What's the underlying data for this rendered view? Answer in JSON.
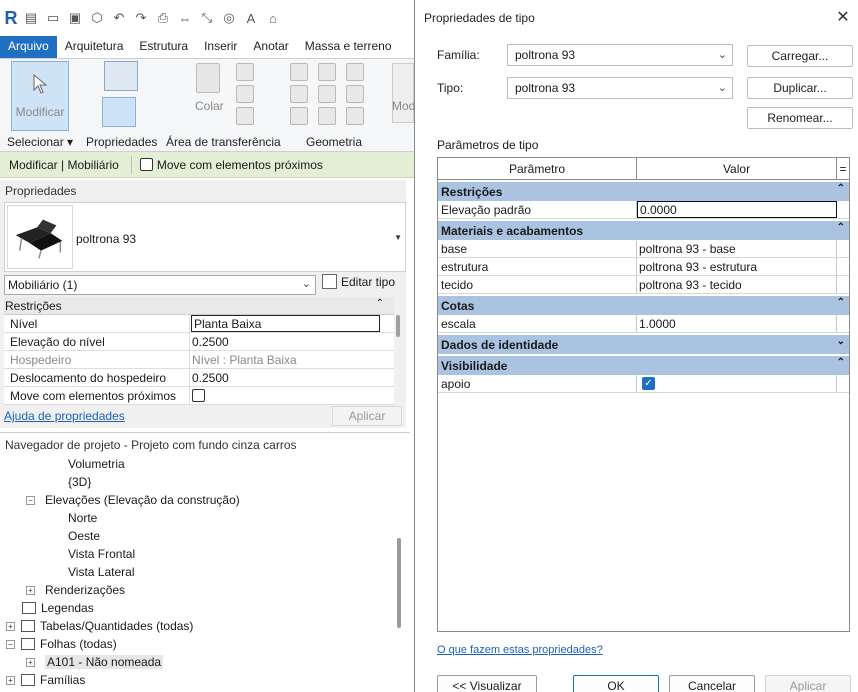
{
  "ribbon": {
    "menu": [
      "Arquivo",
      "Arquitetura",
      "Estrutura",
      "Inserir",
      "Anotar",
      "Massa e terreno"
    ],
    "modify_label": "Modificar",
    "select_label": "Selecionar",
    "properties_label": "Propriedades",
    "clipboard_label": "Área de transferência",
    "geometry_label": "Geometria",
    "paste_label": "Colar",
    "modify_partial_label": "Mod"
  },
  "context_bar": {
    "title": "Modificar | Mobiliário",
    "move_with_nearby": "Move com elementos próximos"
  },
  "properties": {
    "title": "Propriedades",
    "type_name": "poltrona 93",
    "filter": "Mobiliário (1)",
    "edit_type": "Editar tipo",
    "group": "Restrições",
    "rows": [
      {
        "k": "Nível",
        "v": "Planta Baixa"
      },
      {
        "k": "Elevação do nível",
        "v": "0.2500"
      },
      {
        "k": "Hospedeiro",
        "v": "Nível : Planta Baixa"
      },
      {
        "k": "Deslocamento do hospedeiro",
        "v": "0.2500"
      },
      {
        "k": "Move com elementos próximos",
        "v": ""
      }
    ],
    "help": "Ajuda de propriedades",
    "apply": "Aplicar"
  },
  "browser": {
    "title": "Navegador de projeto - Projeto com fundo cinza carros",
    "nodes": [
      {
        "label": "Volumetria"
      },
      {
        "label": "{3D}"
      },
      {
        "label": "Elevações (Elevação da construção)"
      },
      {
        "label": "Norte"
      },
      {
        "label": "Oeste"
      },
      {
        "label": "Vista Frontal"
      },
      {
        "label": "Vista Lateral"
      },
      {
        "label": "Renderizações"
      },
      {
        "label": "Legendas"
      },
      {
        "label": "Tabelas/Quantidades (todas)"
      },
      {
        "label": "Folhas (todas)"
      },
      {
        "label": "A101 - Não nomeada"
      },
      {
        "label": "Famílias"
      }
    ]
  },
  "dialog": {
    "title": "Propriedades de tipo",
    "family_label": "Família:",
    "family_value": "poltrona 93",
    "type_label": "Tipo:",
    "type_value": "poltrona 93",
    "load_btn": "Carregar...",
    "duplicate_btn": "Duplicar...",
    "rename_btn": "Renomear...",
    "params_label": "Parâmetros de tipo",
    "col_param": "Parâmetro",
    "col_value": "Valor",
    "col_extra": "=",
    "groups": {
      "restricoes": "Restrições",
      "materiais": "Materiais e acabamentos",
      "cotas": "Cotas",
      "dados": "Dados de identidade",
      "visibilidade": "Visibilidade"
    },
    "rows": {
      "elevacao": {
        "k": "Elevação padrão",
        "v": "0.0000"
      },
      "base": {
        "k": "base",
        "v": "poltrona 93 - base"
      },
      "estrutura": {
        "k": "estrutura",
        "v": "poltrona 93 - estrutura"
      },
      "tecido": {
        "k": "tecido",
        "v": "poltrona 93 - tecido"
      },
      "escala": {
        "k": "escala",
        "v": "1.0000"
      },
      "apoio": {
        "k": "apoio",
        "v": ""
      }
    },
    "help": "O que fazem estas propriedades?",
    "preview_btn": "<< Visualizar",
    "ok_btn": "OK",
    "cancel_btn": "Cancelar",
    "apply_btn": "Aplicar"
  },
  "colors": {
    "accent": "#1f6fc2",
    "group_bg": "#a9c3e0",
    "context_bg": "#e3efd4"
  }
}
